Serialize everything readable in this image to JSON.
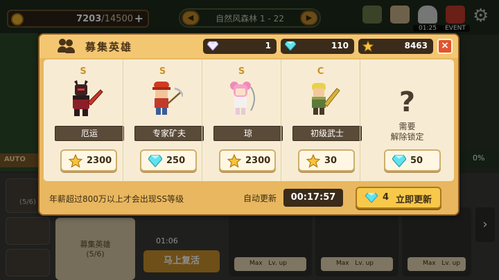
{
  "background": {
    "gold": {
      "current": "7203",
      "max": "/14500",
      "plus": "+"
    },
    "stage": {
      "title": "自然风森林 1 - 22",
      "prev": "◀",
      "next": "▶"
    },
    "top_icons": [
      {
        "name": "map-icon",
        "label": ""
      },
      {
        "name": "scroll-icon",
        "label": ""
      },
      {
        "name": "ghost-icon",
        "label": "01:25"
      },
      {
        "name": "gift-icon",
        "label": "EVENT"
      }
    ],
    "auto_label": "AUTO",
    "right_percent": "0%",
    "side_count": "(5/6)",
    "recruit_card": {
      "title": "募集英雄",
      "count": "(5/6)"
    },
    "revive_timer": "01:06",
    "revive_label": "马上复活",
    "slot_labels": [
      "Max",
      "Lv. up"
    ]
  },
  "modal": {
    "title": "募集英雄",
    "currencies": [
      {
        "icon": "white-gem-icon",
        "value": "1"
      },
      {
        "icon": "blue-gem-icon",
        "value": "110"
      },
      {
        "icon": "star-icon",
        "value": "8463"
      }
    ],
    "close": "×",
    "heroes": [
      {
        "grade": "S",
        "name": "厄运",
        "price_icon": "star-icon",
        "price": "2300",
        "sprite": "dark-knight"
      },
      {
        "grade": "S",
        "name": "专家矿夫",
        "price_icon": "gem-icon",
        "price": "250",
        "sprite": "miner"
      },
      {
        "grade": "S",
        "name": "琼",
        "price_icon": "star-icon",
        "price": "2300",
        "sprite": "archer"
      },
      {
        "grade": "C",
        "name": "初级武士",
        "price_icon": "star-icon",
        "price": "30",
        "sprite": "warrior"
      },
      {
        "locked": true,
        "locked_mark": "?",
        "locked_line1": "需要",
        "locked_line2": "解除锁定",
        "price_icon": "gem-icon",
        "price": "50"
      }
    ],
    "footer": {
      "note": "年薪超过800万以上才会出现SS等级",
      "auto_label": "自动更新",
      "timer": "00:17:57",
      "refresh_cost": "4",
      "refresh_label": "立即更新"
    }
  },
  "colors": {
    "modal_bg": "#e9b75f",
    "header_bg": "#f3c772",
    "body_bg": "#f7ecd3",
    "close_red": "#e2542d",
    "grade_gold": "#c9932b",
    "refresh_yellow": "#f8c84a"
  }
}
